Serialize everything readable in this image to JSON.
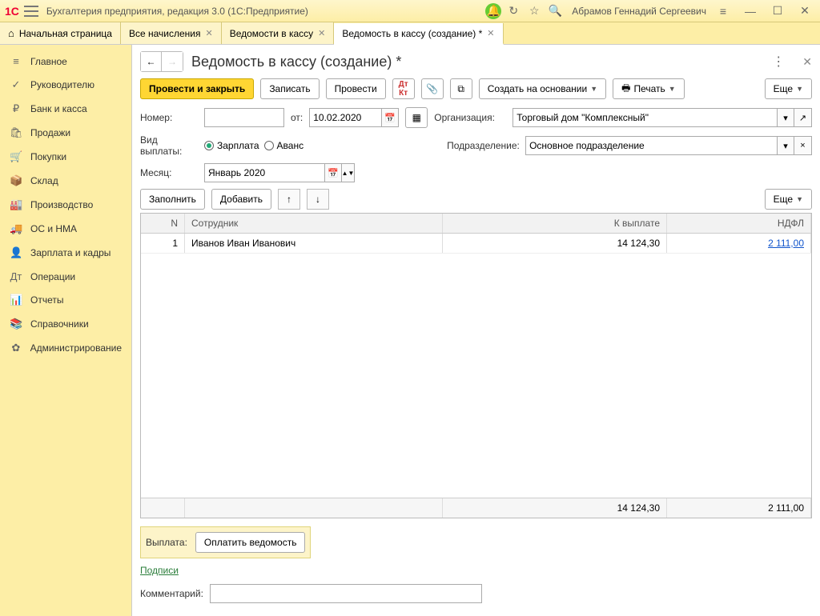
{
  "titlebar": {
    "app_title": "Бухгалтерия предприятия, редакция 3.0  (1С:Предприятие)",
    "username": "Абрамов Геннадий Сергеевич"
  },
  "tabs": [
    {
      "label": "Начальная страница",
      "closable": false,
      "home": true
    },
    {
      "label": "Все начисления",
      "closable": true
    },
    {
      "label": "Ведомости в кассу",
      "closable": true
    },
    {
      "label": "Ведомость в кассу (создание) *",
      "closable": true,
      "active": true
    }
  ],
  "sidebar": [
    {
      "icon": "≡",
      "label": "Главное"
    },
    {
      "icon": "✓",
      "label": "Руководителю"
    },
    {
      "icon": "₽",
      "label": "Банк и касса"
    },
    {
      "icon": "🛍",
      "label": "Продажи"
    },
    {
      "icon": "🛒",
      "label": "Покупки"
    },
    {
      "icon": "📦",
      "label": "Склад"
    },
    {
      "icon": "🏭",
      "label": "Производство"
    },
    {
      "icon": "🚚",
      "label": "ОС и НМА"
    },
    {
      "icon": "👤",
      "label": "Зарплата и кадры"
    },
    {
      "icon": "Дт",
      "label": "Операции"
    },
    {
      "icon": "📊",
      "label": "Отчеты"
    },
    {
      "icon": "📚",
      "label": "Справочники"
    },
    {
      "icon": "✿",
      "label": "Администрирование"
    }
  ],
  "page": {
    "title": "Ведомость в кассу (создание) *",
    "toolbar": {
      "post_close": "Провести и закрыть",
      "save": "Записать",
      "post": "Провести",
      "create_based": "Создать на основании",
      "print": "Печать",
      "more": "Еще"
    },
    "form": {
      "number_label": "Номер:",
      "number_value": "",
      "date_label": "от:",
      "date_value": "10.02.2020",
      "org_label": "Организация:",
      "org_value": "Торговый дом \"Комплексный\"",
      "paytype_label": "Вид выплаты:",
      "paytype_salary": "Зарплата",
      "paytype_advance": "Аванс",
      "dept_label": "Подразделение:",
      "dept_value": "Основное подразделение",
      "month_label": "Месяц:",
      "month_value": "Январь 2020"
    },
    "subtoolbar": {
      "fill": "Заполнить",
      "add": "Добавить",
      "more": "Еще"
    },
    "table": {
      "headers": {
        "n": "N",
        "employee": "Сотрудник",
        "topay": "К выплате",
        "tax": "НДФЛ"
      },
      "rows": [
        {
          "n": "1",
          "employee": "Иванов Иван Иванович",
          "topay": "14 124,30",
          "tax": "2 111,00"
        }
      ],
      "totals": {
        "topay": "14 124,30",
        "tax": "2 111,00"
      }
    },
    "footer": {
      "payment_label": "Выплата:",
      "pay_sheet": "Оплатить ведомость",
      "signatures": "Подписи",
      "comment_label": "Комментарий:",
      "comment_value": ""
    }
  }
}
